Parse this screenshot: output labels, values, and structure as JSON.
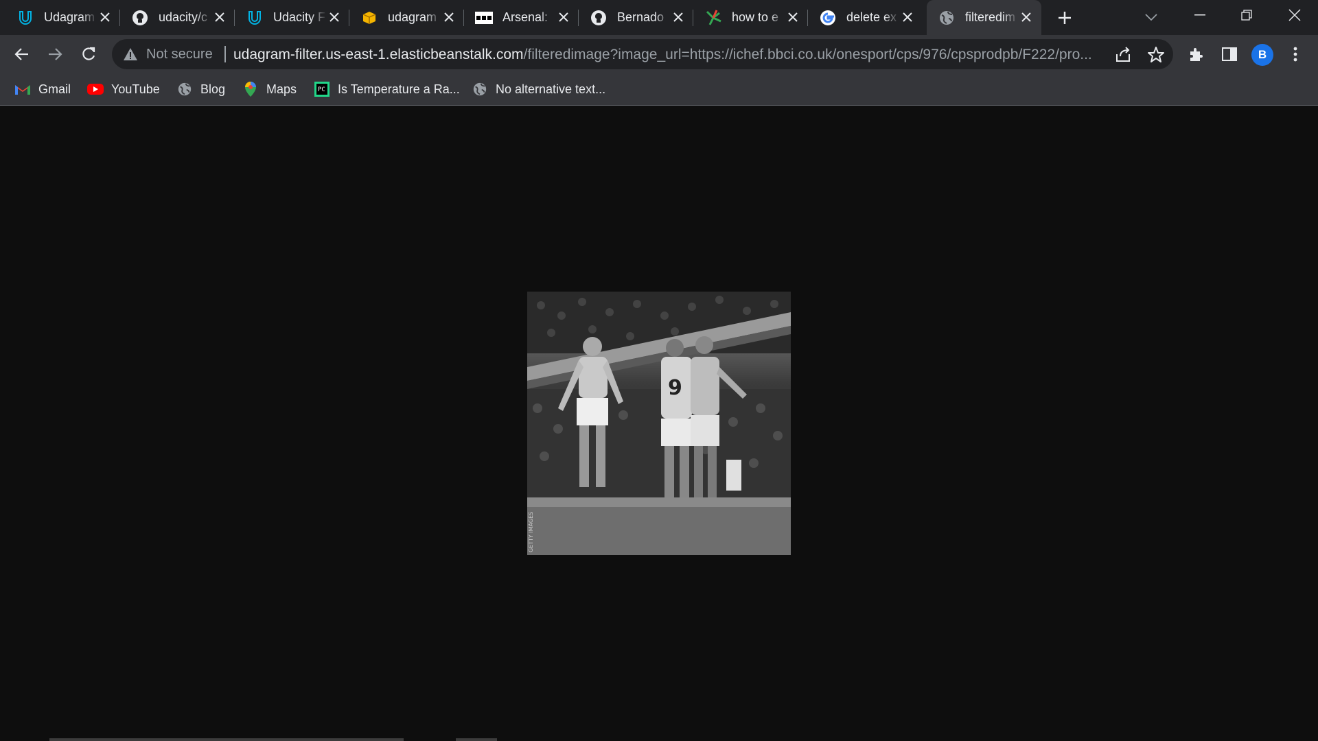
{
  "tabs": [
    {
      "title": "Udagram",
      "icon": "udacity-icon"
    },
    {
      "title": "udacity/c",
      "icon": "github-icon"
    },
    {
      "title": "Udacity F",
      "icon": "udacity-icon"
    },
    {
      "title": "udagram",
      "icon": "package-icon"
    },
    {
      "title": "Arsenal: ",
      "icon": "bbc-icon"
    },
    {
      "title": "Bernado",
      "icon": "github-icon"
    },
    {
      "title": "how to e",
      "icon": "pinwheel-icon"
    },
    {
      "title": "delete ex",
      "icon": "google-icon"
    },
    {
      "title": "filteredim",
      "icon": "globe-icon",
      "active": true
    }
  ],
  "omnibox": {
    "security_label": "Not secure",
    "url_host": "udagram-filter.us-east-1.elasticbeanstalk.com",
    "url_path": "/filteredimage?image_url=https://ichef.bbci.co.uk/onesport/cps/976/cpsprodpb/F222/pro..."
  },
  "profile": {
    "initial": "B",
    "color": "#1a73e8"
  },
  "bookmarks": [
    {
      "label": "Gmail",
      "icon": "gmail-icon"
    },
    {
      "label": "YouTube",
      "icon": "youtube-icon"
    },
    {
      "label": "Blog",
      "icon": "globe-icon"
    },
    {
      "label": "Maps",
      "icon": "maps-icon"
    },
    {
      "label": "Is Temperature a Ra...",
      "icon": "pycharm-icon"
    },
    {
      "label": "No alternative text...",
      "icon": "globe-icon"
    }
  ],
  "content": {
    "image_description": "grayscale-football-photo",
    "background": "#0e0e0e"
  }
}
